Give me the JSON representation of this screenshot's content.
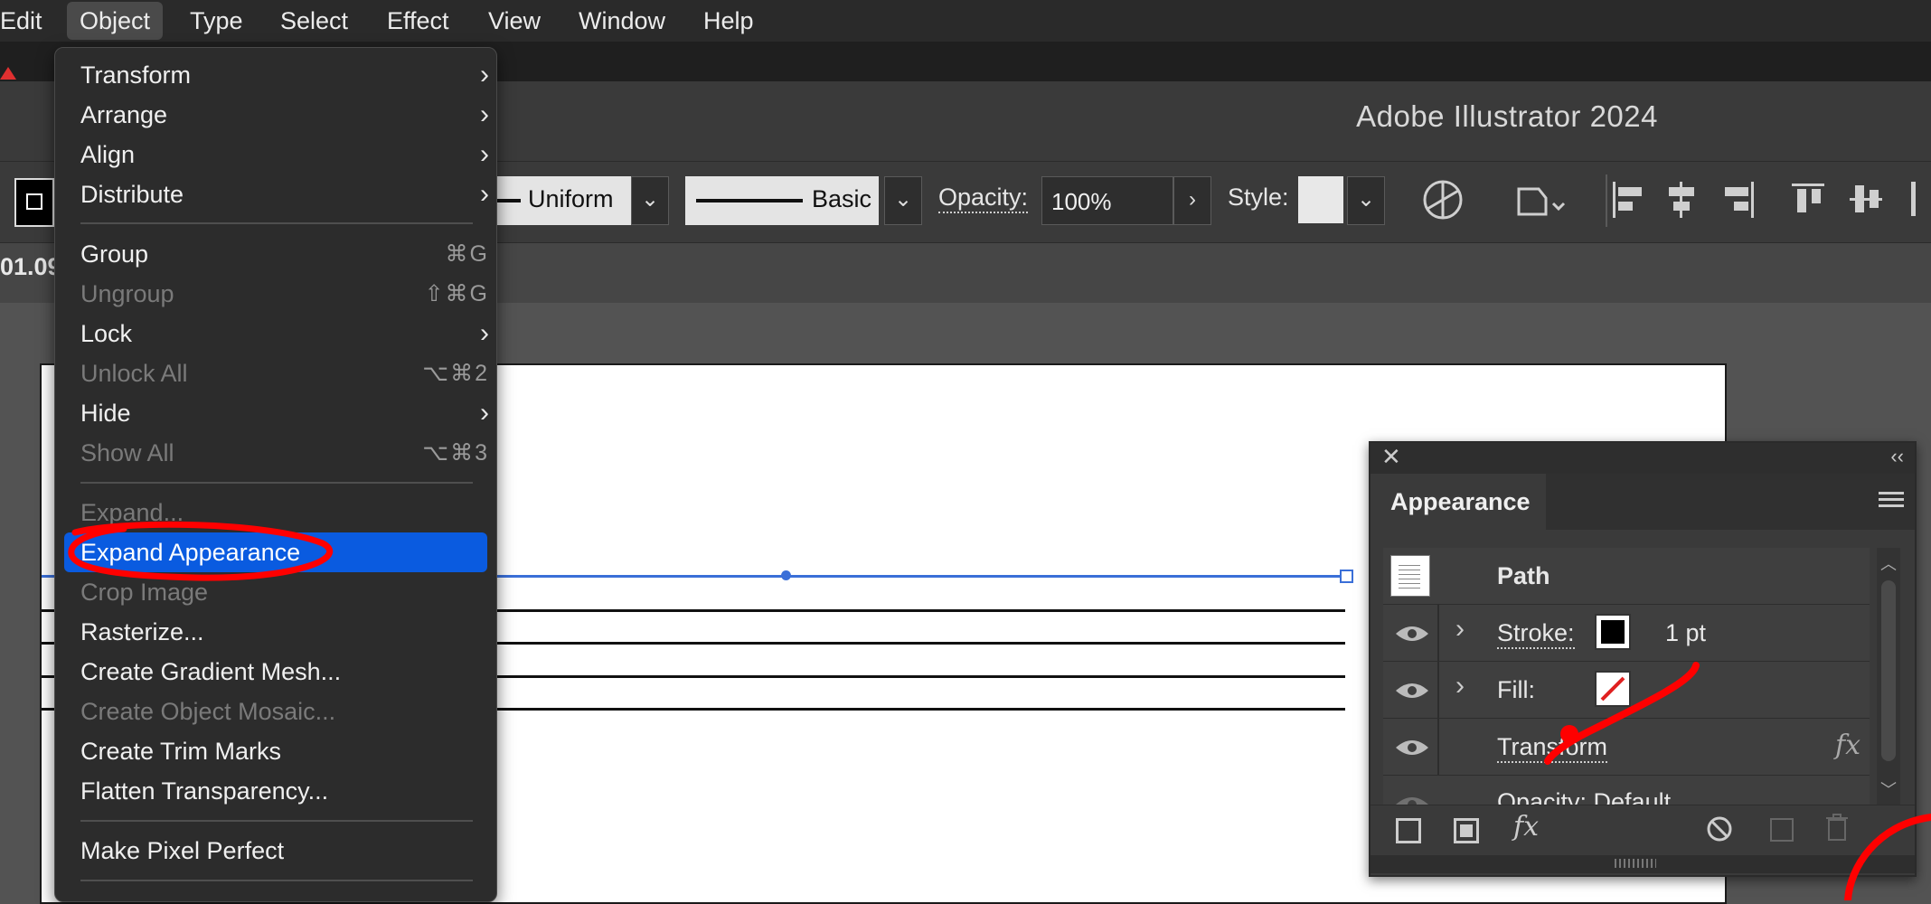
{
  "menubar": {
    "items": [
      "Edit",
      "Object",
      "Type",
      "Select",
      "Effect",
      "View",
      "Window",
      "Help"
    ],
    "active": "Object"
  },
  "window": {
    "app_title": "Adobe Illustrator 2024",
    "doc_zoom_partial": "01.09"
  },
  "control_bar": {
    "stroke_profile": "Uniform",
    "brush": "Basic",
    "opacity_label": "Opacity:",
    "opacity_value": "100%",
    "style_label": "Style:"
  },
  "object_menu": {
    "items": [
      {
        "label": "Transform",
        "submenu": true
      },
      {
        "label": "Arrange",
        "submenu": true
      },
      {
        "label": "Align",
        "submenu": true
      },
      {
        "label": "Distribute",
        "submenu": true
      },
      {
        "label": "Group",
        "shortcut": "⌘G"
      },
      {
        "label": "Ungroup",
        "shortcut": "⇧⌘G",
        "disabled": true
      },
      {
        "label": "Lock",
        "submenu": true
      },
      {
        "label": "Unlock All",
        "shortcut": "⌥⌘2",
        "disabled": true
      },
      {
        "label": "Hide",
        "submenu": true
      },
      {
        "label": "Show All",
        "shortcut": "⌥⌘3",
        "disabled": true
      },
      {
        "label": "Expand...",
        "disabled": true
      },
      {
        "label": "Expand Appearance",
        "highlighted": true
      },
      {
        "label": "Crop Image",
        "disabled": true
      },
      {
        "label": "Rasterize..."
      },
      {
        "label": "Create Gradient Mesh..."
      },
      {
        "label": "Create Object Mosaic...",
        "disabled": true
      },
      {
        "label": "Create Trim Marks"
      },
      {
        "label": "Flatten Transparency..."
      },
      {
        "label": "Make Pixel Perfect"
      }
    ],
    "highlight_color": "#0a5be0",
    "annotation_color": "#ff0000"
  },
  "appearance_panel": {
    "title": "Appearance",
    "object_type": "Path",
    "stroke_label": "Stroke:",
    "stroke_weight": "1 pt",
    "fill_label": "Fill:",
    "transform_label": "Transform",
    "opacity_row": "Opacity: Default",
    "fx_label": "fx"
  },
  "colors": {
    "menu_bg": "#2c2c2c",
    "panel_bg": "#3a3a3a",
    "canvas_bg": "#535353",
    "selection_blue": "#3a6fd8"
  }
}
